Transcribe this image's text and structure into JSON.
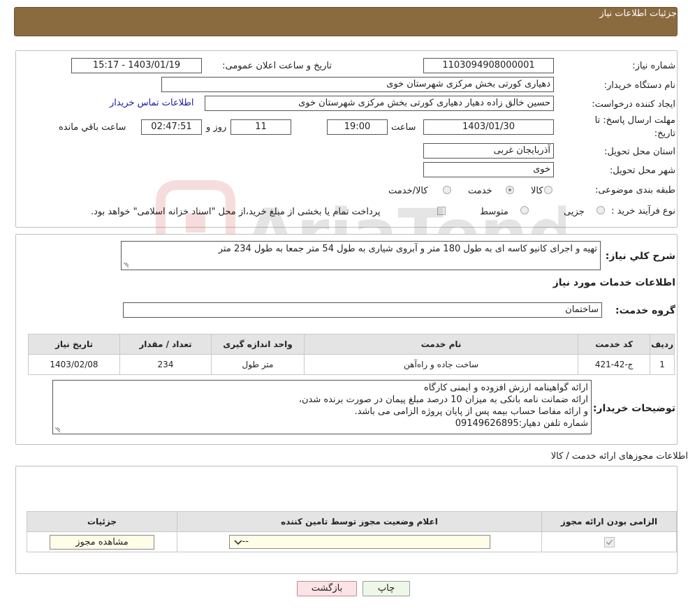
{
  "header": {
    "title": "جزئیات اطلاعات نیاز"
  },
  "info": {
    "need_number_label": "شماره نیاز:",
    "need_number": "1103094908000001",
    "announce_label": "تاریخ و ساعت اعلان عمومی:",
    "announce_value": "1403/01/19 - 15:17",
    "buyer_org_label": "نام دستگاه خریدار:",
    "buyer_org": "دهیاری کورتی بخش مرکزی شهرستان خوی",
    "creator_label": "ایجاد کننده درخواست:",
    "creator": "حسین خالق زاده دهیار دهیاری کورتی بخش مرکزی شهرستان خوی",
    "contact_link": "اطلاعات تماس خریدار",
    "deadline_label_1": "مهلت ارسال پاسخ: تا",
    "deadline_label_2": "تاریخ:",
    "deadline_date": "1403/01/30",
    "time_label": "ساعت",
    "deadline_time": "19:00",
    "days": "11",
    "days_label": "روز و",
    "remaining_time": "02:47:51",
    "remaining_label": "ساعت باقي مانده",
    "province_label": "استان محل تحویل:",
    "province": "آذربایجان غربی",
    "city_label": "شهر محل تحویل:",
    "city": "خوی",
    "category_label": "طبقه بندی موضوعی:",
    "category_options": [
      "کالا",
      "خدمت",
      "کالا/خدمت"
    ],
    "category_selected": "خدمت",
    "process_label": "نوع فرآیند خرید :",
    "process_options": [
      "جزیی",
      "متوسط"
    ],
    "payment_note": "پرداخت تمام یا بخشی از مبلغ خرید،از محل \"اسناد خزانه اسلامی\" خواهد بود."
  },
  "description": {
    "label": "شرح کلي نياز:",
    "text": "تهیه و اجرای کانیو کاسه ای به طول 180 متر و آبروی شیاری به طول 54 متر جمعا به طول 234 متر",
    "services_title": "اطلاعات خدمات مورد نياز",
    "group_label": "گروه خدمت:",
    "group_value": "ساختمان"
  },
  "services_table": {
    "headers": [
      "رديف",
      "کد خدمت",
      "نام خدمت",
      "واحد اندازه گیری",
      "تعداد / مقدار",
      "تاریخ نیاز"
    ],
    "rows": [
      [
        "1",
        "ج-42-421",
        "ساخت جاده و راه‌آهن",
        "متر طول",
        "234",
        "1403/02/08"
      ]
    ]
  },
  "buyer_notes": {
    "label": "توضیحات خریدار:",
    "lines": [
      "ارائه گواهینامه ارزش افزوده و ایمنی کارگاه",
      "ارائه ضمانت نامه بانکی به میزان 10 درصد مبلغ پیمان در صورت برنده شدن،",
      "و ارائه مفاصا حساب بیمه پس از پایان پروژه الزامی می باشد.",
      "شماره تلفن دهیار:09149626895"
    ]
  },
  "permits": {
    "title": "اطلاعات مجوزهای ارائه خدمت / کالا",
    "headers": [
      "الزامی بودن ارائه مجوز",
      "اعلام وضعیت مجوز توسط تامین کننده",
      "جزئیات"
    ],
    "select_value": "--",
    "view_button": "مشاهده مجوز"
  },
  "footer": {
    "print": "چاپ",
    "back": "بازگشت"
  },
  "watermark": {
    "text": "AriaTender.neT"
  }
}
